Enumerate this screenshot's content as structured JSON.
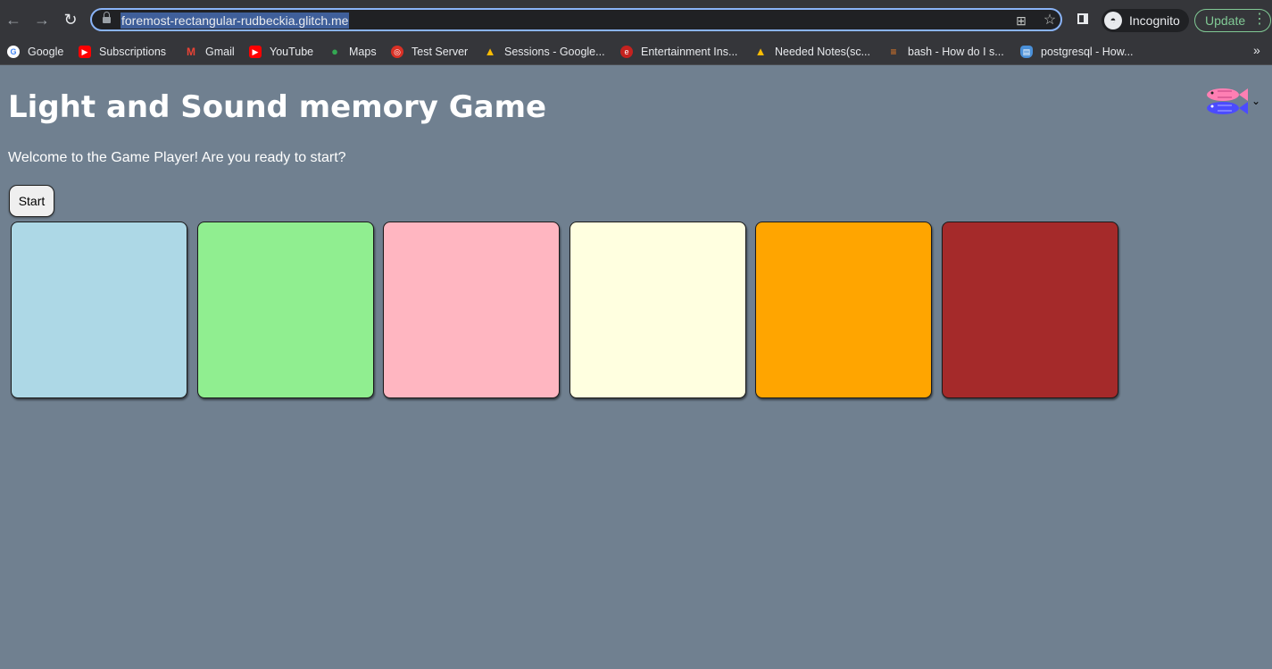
{
  "browser": {
    "url": "foremost-rectangular-rudbeckia.glitch.me",
    "profile_label": "Incognito",
    "update_label": "Update",
    "bookmarks": [
      {
        "label": "Google",
        "icon": "google-icon",
        "color": "#4285f4"
      },
      {
        "label": "Subscriptions",
        "icon": "youtube-icon",
        "color": "#ff0000"
      },
      {
        "label": "Gmail",
        "icon": "gmail-icon",
        "color": "#ea4335"
      },
      {
        "label": "YouTube",
        "icon": "youtube-icon",
        "color": "#ff0000"
      },
      {
        "label": "Maps",
        "icon": "maps-icon",
        "color": "#34a853"
      },
      {
        "label": "Test Server",
        "icon": "target-icon",
        "color": "#d93025"
      },
      {
        "label": "Sessions - Google...",
        "icon": "drive-icon",
        "color": "#fbbc04"
      },
      {
        "label": "Entertainment Ins...",
        "icon": "red-circle-icon",
        "color": "#c5221f"
      },
      {
        "label": "Needed Notes(sc...",
        "icon": "drive-icon",
        "color": "#fbbc04"
      },
      {
        "label": "bash - How do I s...",
        "icon": "stackoverflow-icon",
        "color": "#f48024"
      },
      {
        "label": "postgresql - How...",
        "icon": "database-icon",
        "color": "#4a90d9"
      }
    ]
  },
  "page": {
    "title": "Light and Sound memory Game",
    "welcome": "Welcome to the Game Player! Are you ready to start?",
    "start_label": "Start",
    "game_buttons": [
      {
        "name": "game-button-1",
        "color": "#add8e6"
      },
      {
        "name": "game-button-2",
        "color": "#90ee90"
      },
      {
        "name": "game-button-3",
        "color": "#ffb6c1"
      },
      {
        "name": "game-button-4",
        "color": "#ffffe0"
      },
      {
        "name": "game-button-5",
        "color": "#ffa500"
      },
      {
        "name": "game-button-6",
        "color": "#a52a2a"
      }
    ]
  },
  "colors": {
    "page_background": "#708090",
    "browser_chrome": "#35363a",
    "accent": "#8ab4f8"
  }
}
